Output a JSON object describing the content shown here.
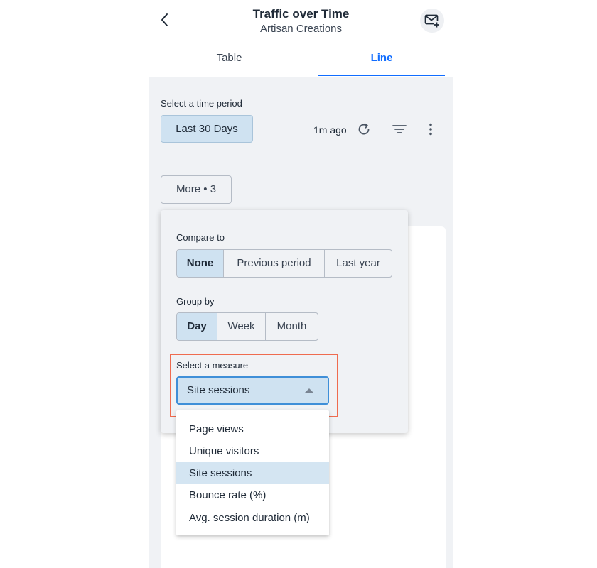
{
  "header": {
    "title": "Traffic over Time",
    "subtitle": "Artisan Creations",
    "back_icon": "chevron-left-icon",
    "mail_icon": "mail-plus-icon"
  },
  "tabs": [
    {
      "label": "Table",
      "active": false
    },
    {
      "label": "Line",
      "active": true
    }
  ],
  "controls": {
    "period_label": "Select a time period",
    "period_value": "Last 30 Days",
    "updated_text": "1m ago",
    "refresh_icon": "refresh-icon",
    "filter_icon": "filter-icon",
    "more_icon": "more-vertical-icon",
    "more_button": "More • 3"
  },
  "popover": {
    "compare_label": "Compare to",
    "compare_options": [
      "None",
      "Previous period",
      "Last year"
    ],
    "compare_selected": "None",
    "group_label": "Group by",
    "group_options": [
      "Day",
      "Week",
      "Month"
    ],
    "group_selected": "Day",
    "measure_label": "Select a measure",
    "measure_value": "Site sessions",
    "measure_options": [
      "Page views",
      "Unique visitors",
      "Site sessions",
      "Bounce rate (%)",
      "Avg. session duration (m)"
    ],
    "measure_selected": "Site sessions"
  },
  "colors": {
    "accent": "#116dff",
    "selected_bg": "#cfe2f1",
    "highlight_border": "#ef6b4f",
    "panel_bg": "#f0f2f5"
  }
}
